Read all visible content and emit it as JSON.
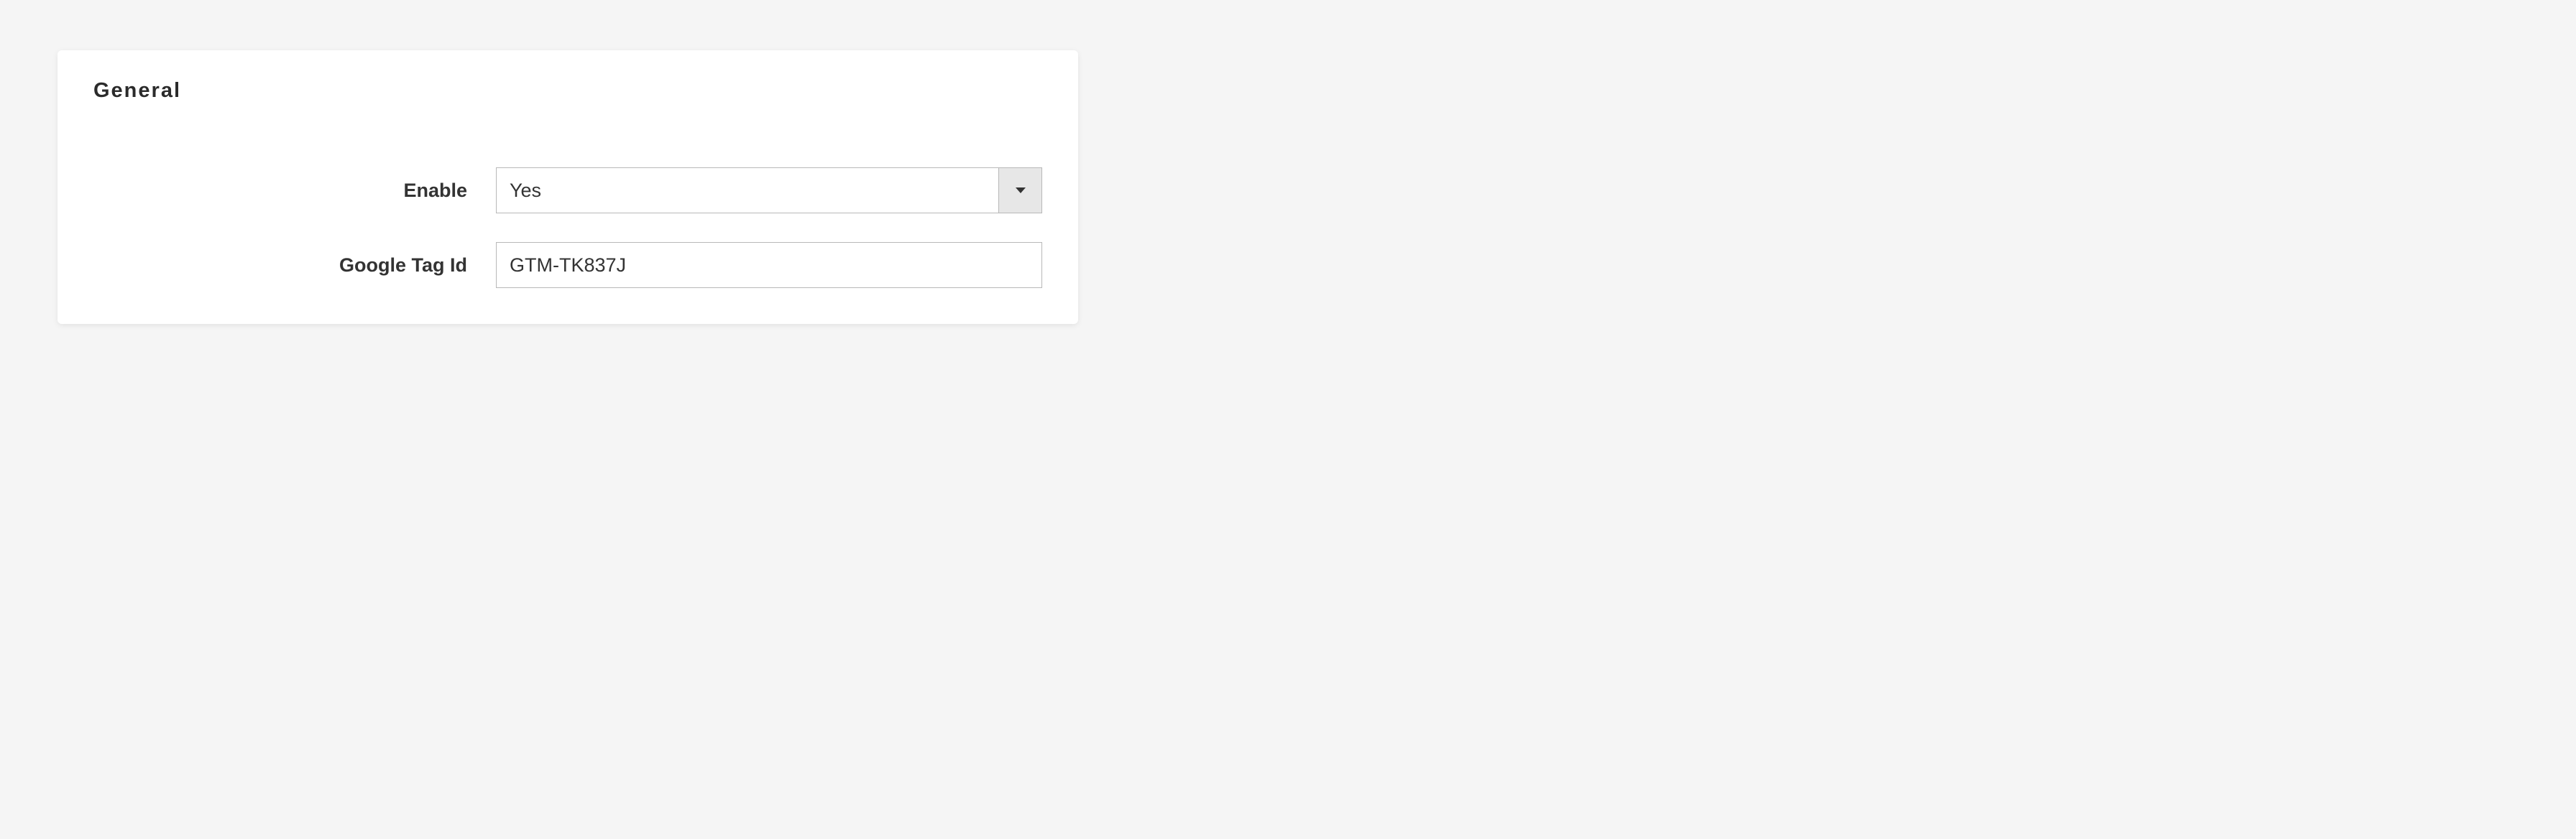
{
  "section": {
    "title": "General"
  },
  "fields": {
    "enable": {
      "label": "Enable",
      "value": "Yes"
    },
    "google_tag_id": {
      "label": "Google Tag Id",
      "value": "GTM-TK837J"
    }
  }
}
